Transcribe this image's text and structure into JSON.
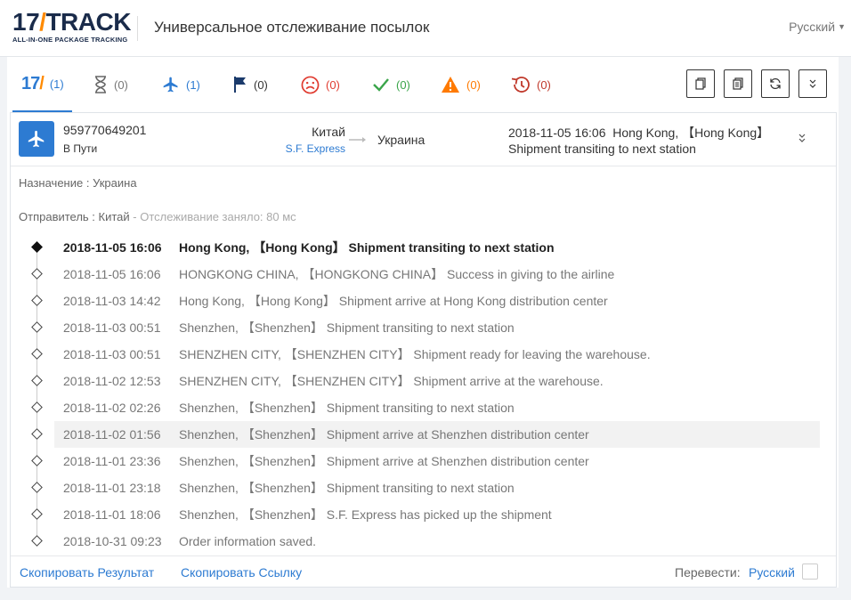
{
  "header": {
    "logo_main": "17TRACK",
    "logo_sub": "ALL-IN-ONE PACKAGE TRACKING",
    "title": "Универсальное отслеживание посылок",
    "language": "Русский"
  },
  "tabs": [
    {
      "name": "all",
      "count": "(1)",
      "icon": "17-logo-icon",
      "color": "#2d7bd2"
    },
    {
      "name": "not-found",
      "count": "(0)",
      "icon": "hourglass-icon",
      "color": "#777777"
    },
    {
      "name": "in-transit",
      "count": "(1)",
      "icon": "plane-icon",
      "color": "#2d7bd2"
    },
    {
      "name": "pickup",
      "count": "(0)",
      "icon": "flag-icon",
      "color": "#1a3a6b"
    },
    {
      "name": "undelivered",
      "count": "(0)",
      "icon": "sad-face-icon",
      "color": "#e03c31"
    },
    {
      "name": "delivered",
      "count": "(0)",
      "icon": "check-icon",
      "color": "#3aa54a"
    },
    {
      "name": "alert",
      "count": "(0)",
      "icon": "warning-icon",
      "color": "#ff7a00"
    },
    {
      "name": "expired",
      "count": "(0)",
      "icon": "history-icon",
      "color": "#c0392b"
    }
  ],
  "toolbar": [
    "copy-icon",
    "copy-all-icon",
    "refresh-icon",
    "collapse-all-icon"
  ],
  "shipment": {
    "number": "959770649201",
    "status": "В Пути",
    "origin": "Китай",
    "carrier": "S.F. Express",
    "destination": "Украина",
    "latest_time": "2018-11-05 16:06",
    "latest_location": "Hong Kong, 【Hong Kong】",
    "latest_desc": "Shipment transiting to next station"
  },
  "info": {
    "destination_line": "Назначение : Украина",
    "sender_line": "Отправитель : Китай",
    "tracking_time": "- Отслеживание заняло: 80 мс"
  },
  "events": [
    {
      "time": "2018-11-05 16:06",
      "desc": "Hong Kong, 【Hong Kong】 Shipment transiting to next station"
    },
    {
      "time": "2018-11-05 16:06",
      "desc": "HONGKONG CHINA, 【HONGKONG CHINA】 Success in giving to the airline"
    },
    {
      "time": "2018-11-03 14:42",
      "desc": "Hong Kong, 【Hong Kong】 Shipment arrive at Hong Kong distribution center"
    },
    {
      "time": "2018-11-03 00:51",
      "desc": "Shenzhen, 【Shenzhen】 Shipment transiting to next station"
    },
    {
      "time": "2018-11-03 00:51",
      "desc": "SHENZHEN CITY, 【SHENZHEN CITY】 Shipment ready for leaving the warehouse."
    },
    {
      "time": "2018-11-02 12:53",
      "desc": "SHENZHEN CITY, 【SHENZHEN CITY】 Shipment arrive at the warehouse."
    },
    {
      "time": "2018-11-02 02:26",
      "desc": "Shenzhen, 【Shenzhen】 Shipment transiting to next station"
    },
    {
      "time": "2018-11-02 01:56",
      "desc": "Shenzhen, 【Shenzhen】 Shipment arrive at Shenzhen distribution center"
    },
    {
      "time": "2018-11-01 23:36",
      "desc": "Shenzhen, 【Shenzhen】 Shipment arrive at Shenzhen distribution center"
    },
    {
      "time": "2018-11-01 23:18",
      "desc": "Shenzhen, 【Shenzhen】 Shipment transiting to next station"
    },
    {
      "time": "2018-11-01 18:06",
      "desc": "Shenzhen, 【Shenzhen】 S.F. Express has picked up the shipment"
    },
    {
      "time": "2018-10-31 09:23",
      "desc": "Order information saved."
    }
  ],
  "footer": {
    "copy_result": "Скопировать Результат",
    "copy_link": "Скопировать Ссылку",
    "translate_label": "Перевести:",
    "translate_lang": "Русский"
  },
  "colors": {
    "accent": "#2d7bd2",
    "brand_orange": "#ff8a00"
  }
}
